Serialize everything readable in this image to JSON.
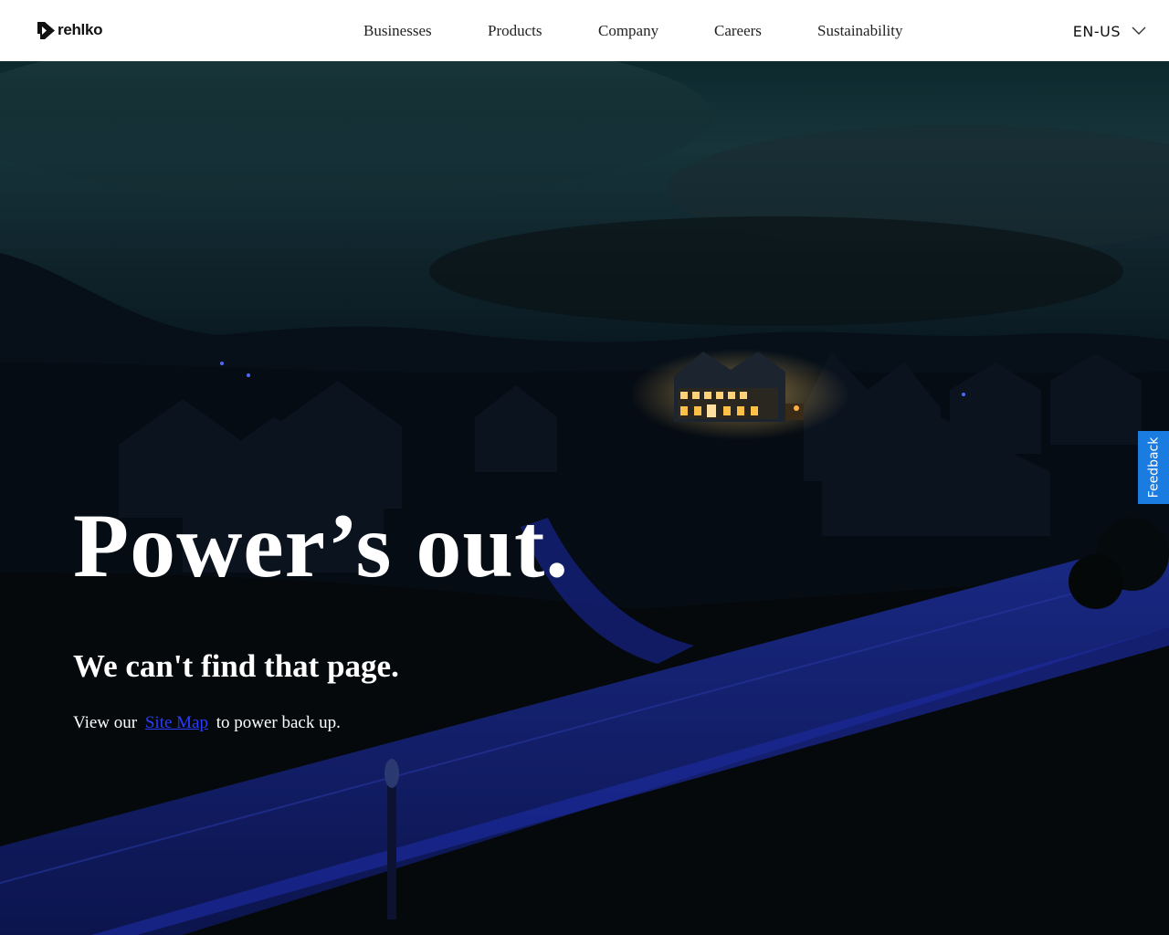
{
  "header": {
    "logo_text": "rehlko",
    "nav": [
      {
        "label": "Businesses"
      },
      {
        "label": "Products"
      },
      {
        "label": "Company"
      },
      {
        "label": "Careers"
      },
      {
        "label": "Sustainability"
      }
    ],
    "language": "EN-US"
  },
  "hero": {
    "headline": "Power’s out.",
    "subheading": "We can't find that page.",
    "body_prefix": "View our",
    "link_label": "Site Map",
    "body_suffix": "to power back up."
  },
  "feedback_label": "Feedback",
  "colors": {
    "link": "#2a3cff",
    "feedback_bg": "#1a7be0",
    "header_bg": "#ffffff"
  }
}
